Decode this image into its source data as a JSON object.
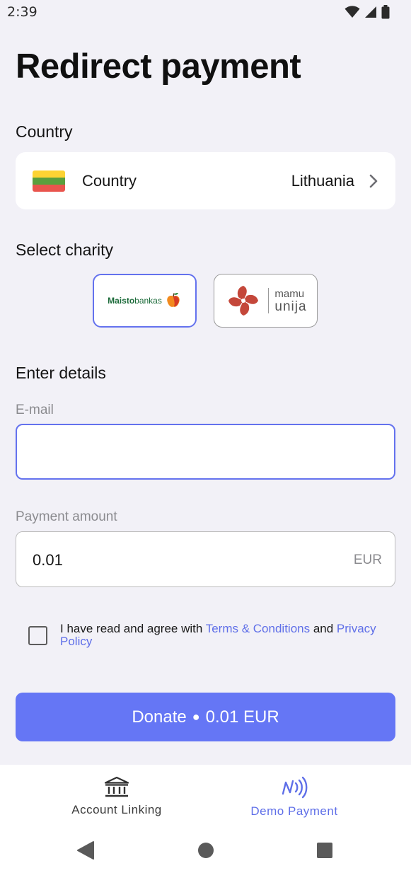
{
  "status_bar": {
    "time": "2:39"
  },
  "page": {
    "title": "Redirect payment"
  },
  "country_section": {
    "heading": "Country",
    "row_label": "Country",
    "selected_country": "Lithuania",
    "flag_colors": [
      "#fcd333",
      "#5a9f3d",
      "#e9544d"
    ]
  },
  "charity_section": {
    "heading": "Select charity",
    "charities": [
      {
        "name_part1": "Maisto",
        "name_part2": "bankas",
        "selected": true
      },
      {
        "name_line1": "mamu",
        "name_line2": "unija",
        "selected": false
      }
    ]
  },
  "details_section": {
    "heading": "Enter details",
    "email_label": "E-mail",
    "email_value": "",
    "amount_label": "Payment amount",
    "amount_value": "0.01",
    "amount_currency": "EUR"
  },
  "terms": {
    "text_before": "I have read and agree with ",
    "terms_link": "Terms & Conditions",
    "text_middle": " and ",
    "privacy_link": "Privacy Policy",
    "checked": false
  },
  "donate_button": {
    "label": "Donate",
    "separator": "●",
    "amount": "0.01 EUR"
  },
  "bottom_nav": {
    "items": [
      {
        "label": "Account Linking",
        "icon": "bank-icon",
        "active": false
      },
      {
        "label": "Demo Payment",
        "icon": "nfc-payment-icon",
        "active": true
      }
    ]
  },
  "colors": {
    "accent": "#6576f5",
    "background": "#f2f1f7",
    "link": "#5f6fe8",
    "maisto_green": "#1c6b3a",
    "mamu_red": "#c4473a"
  }
}
